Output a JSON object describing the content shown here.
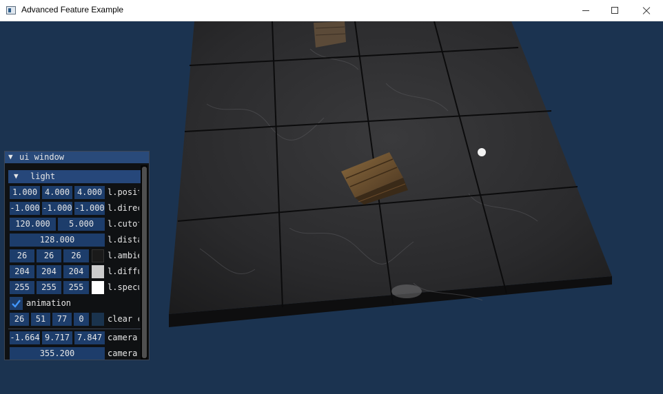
{
  "window": {
    "title": "Advanced Feature Example",
    "controls": {
      "minimize": "minimize",
      "maximize": "maximize",
      "close": "close"
    }
  },
  "colors": {
    "background": "#1b3350",
    "ui_title": "#294a7a",
    "ui_field": "#1d3d6b",
    "ambient_swatch": "#1a1a1a",
    "diffuse_swatch": "#cccccc",
    "specular_swatch": "#ffffff"
  },
  "ui_window": {
    "title": "ui window",
    "collapse_glyph": "▼",
    "light_header": {
      "glyph": "▼",
      "label": "light"
    },
    "rows": {
      "position": {
        "values": [
          "1.000",
          "4.000",
          "4.000"
        ],
        "label": "l.position"
      },
      "direction": {
        "values": [
          "-1.000",
          "-1.000",
          "-1.000"
        ],
        "label": "l.direction"
      },
      "cutoff": {
        "values": [
          "120.000",
          "5.000"
        ],
        "label": "l.cutoff"
      },
      "distance": {
        "value": "128.000",
        "label": "l.distance"
      },
      "ambient": {
        "values": [
          "26",
          "26",
          "26"
        ],
        "label": "l.ambient"
      },
      "diffuse": {
        "values": [
          "204",
          "204",
          "204"
        ],
        "label": "l.diffuse"
      },
      "specular": {
        "values": [
          "255",
          "255",
          "255"
        ],
        "label": "l.specular"
      },
      "animation": {
        "checked": true,
        "label": "animation"
      },
      "clear_color": {
        "values": [
          "26",
          "51",
          "77",
          "0"
        ],
        "label": "clear color"
      },
      "camera_pos": {
        "values": [
          "-1.664",
          "9.717",
          "7.847"
        ],
        "label": "camera pos"
      },
      "camera_angle": {
        "value": "355.200",
        "label": "camera angle"
      }
    }
  }
}
